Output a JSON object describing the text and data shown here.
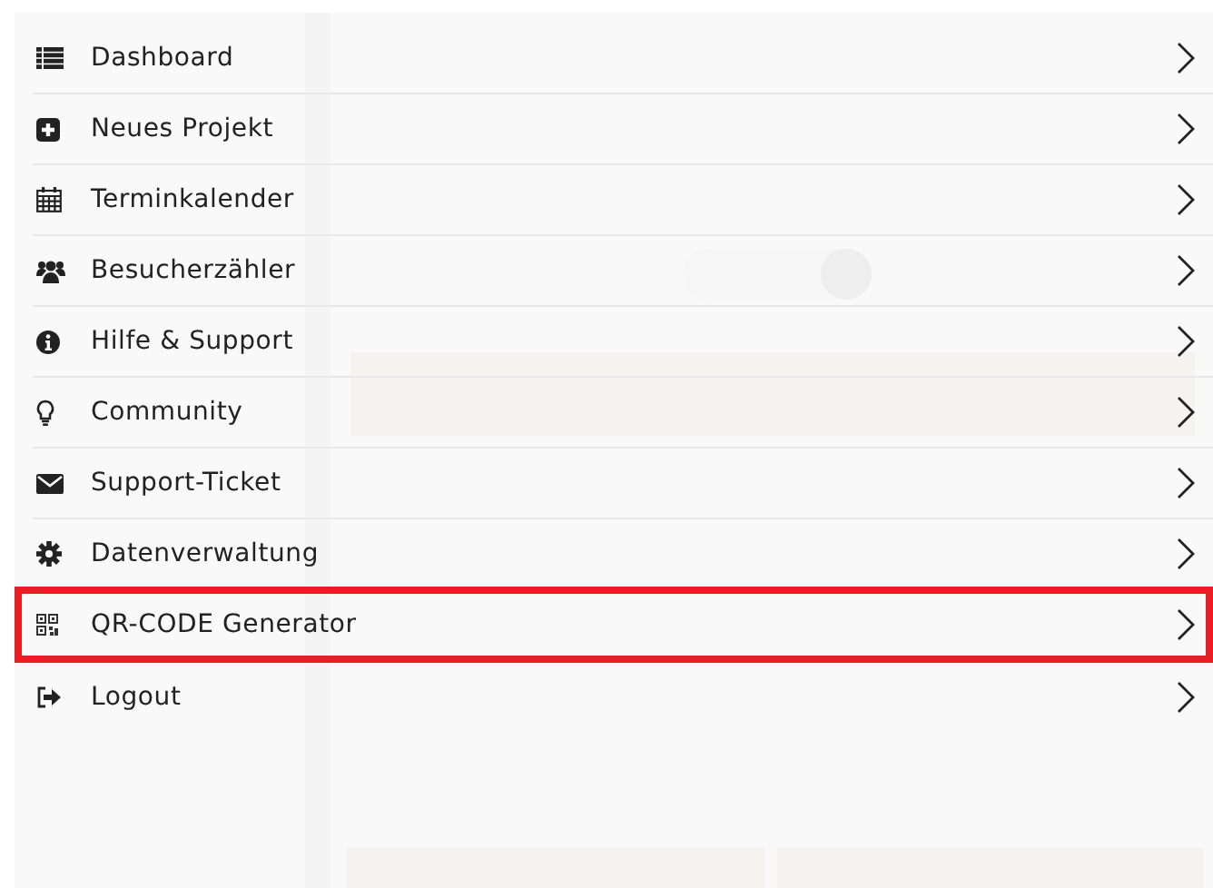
{
  "menu": {
    "items": [
      {
        "label": "Dashboard",
        "highlighted": false
      },
      {
        "label": "Neues Projekt",
        "highlighted": false
      },
      {
        "label": "Terminkalender",
        "highlighted": false
      },
      {
        "label": "Besucherzähler",
        "highlighted": false
      },
      {
        "label": "Hilfe & Support",
        "highlighted": false
      },
      {
        "label": "Community",
        "highlighted": false
      },
      {
        "label": "Support-Ticket",
        "highlighted": false
      },
      {
        "label": "Datenverwaltung",
        "highlighted": false
      },
      {
        "label": "QR-CODE Generator",
        "highlighted": true
      },
      {
        "label": "Logout",
        "highlighted": false
      }
    ]
  }
}
